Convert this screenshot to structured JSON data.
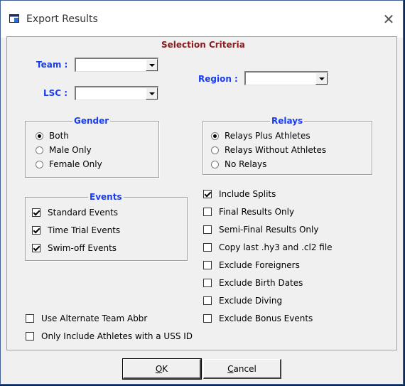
{
  "window": {
    "title": "Export Results"
  },
  "criteria": {
    "title": "Selection Criteria"
  },
  "fields": {
    "team_label": "Team :",
    "lsc_label": "LSC :",
    "region_label": "Region :",
    "team_value": "",
    "lsc_value": "",
    "region_value": ""
  },
  "gender": {
    "legend": "Gender",
    "options": [
      {
        "label": "Both",
        "selected": true
      },
      {
        "label": "Male Only",
        "selected": false
      },
      {
        "label": "Female Only",
        "selected": false
      }
    ]
  },
  "relays": {
    "legend": "Relays",
    "options": [
      {
        "label": "Relays Plus Athletes",
        "selected": true
      },
      {
        "label": "Relays Without Athletes",
        "selected": false
      },
      {
        "label": "No Relays",
        "selected": false
      }
    ]
  },
  "events": {
    "legend": "Events",
    "options": [
      {
        "label": "Standard Events",
        "checked": true
      },
      {
        "label": "Time Trial Events",
        "checked": true
      },
      {
        "label": "Swim-off Events",
        "checked": true
      }
    ]
  },
  "options_right": [
    {
      "label": "Include Splits",
      "checked": true
    },
    {
      "label": "Final Results Only",
      "checked": false
    },
    {
      "label": "Semi-Final Results Only",
      "checked": false
    },
    {
      "label": "Copy last .hy3 and .cl2 file",
      "checked": false
    },
    {
      "label": "Exclude Foreigners",
      "checked": false
    },
    {
      "label": "Exclude Birth Dates",
      "checked": false
    },
    {
      "label": "Exclude Diving",
      "checked": false
    },
    {
      "label": "Exclude Bonus Events",
      "checked": false
    }
  ],
  "options_left": [
    {
      "label": "Use Alternate Team Abbr",
      "checked": false
    },
    {
      "label": "Only Include Athletes with a USS ID",
      "checked": false
    }
  ],
  "buttons": {
    "ok_pre": "",
    "ok_u": "O",
    "ok_post": "K",
    "cancel_pre": "",
    "cancel_u": "C",
    "cancel_post": "ancel"
  }
}
